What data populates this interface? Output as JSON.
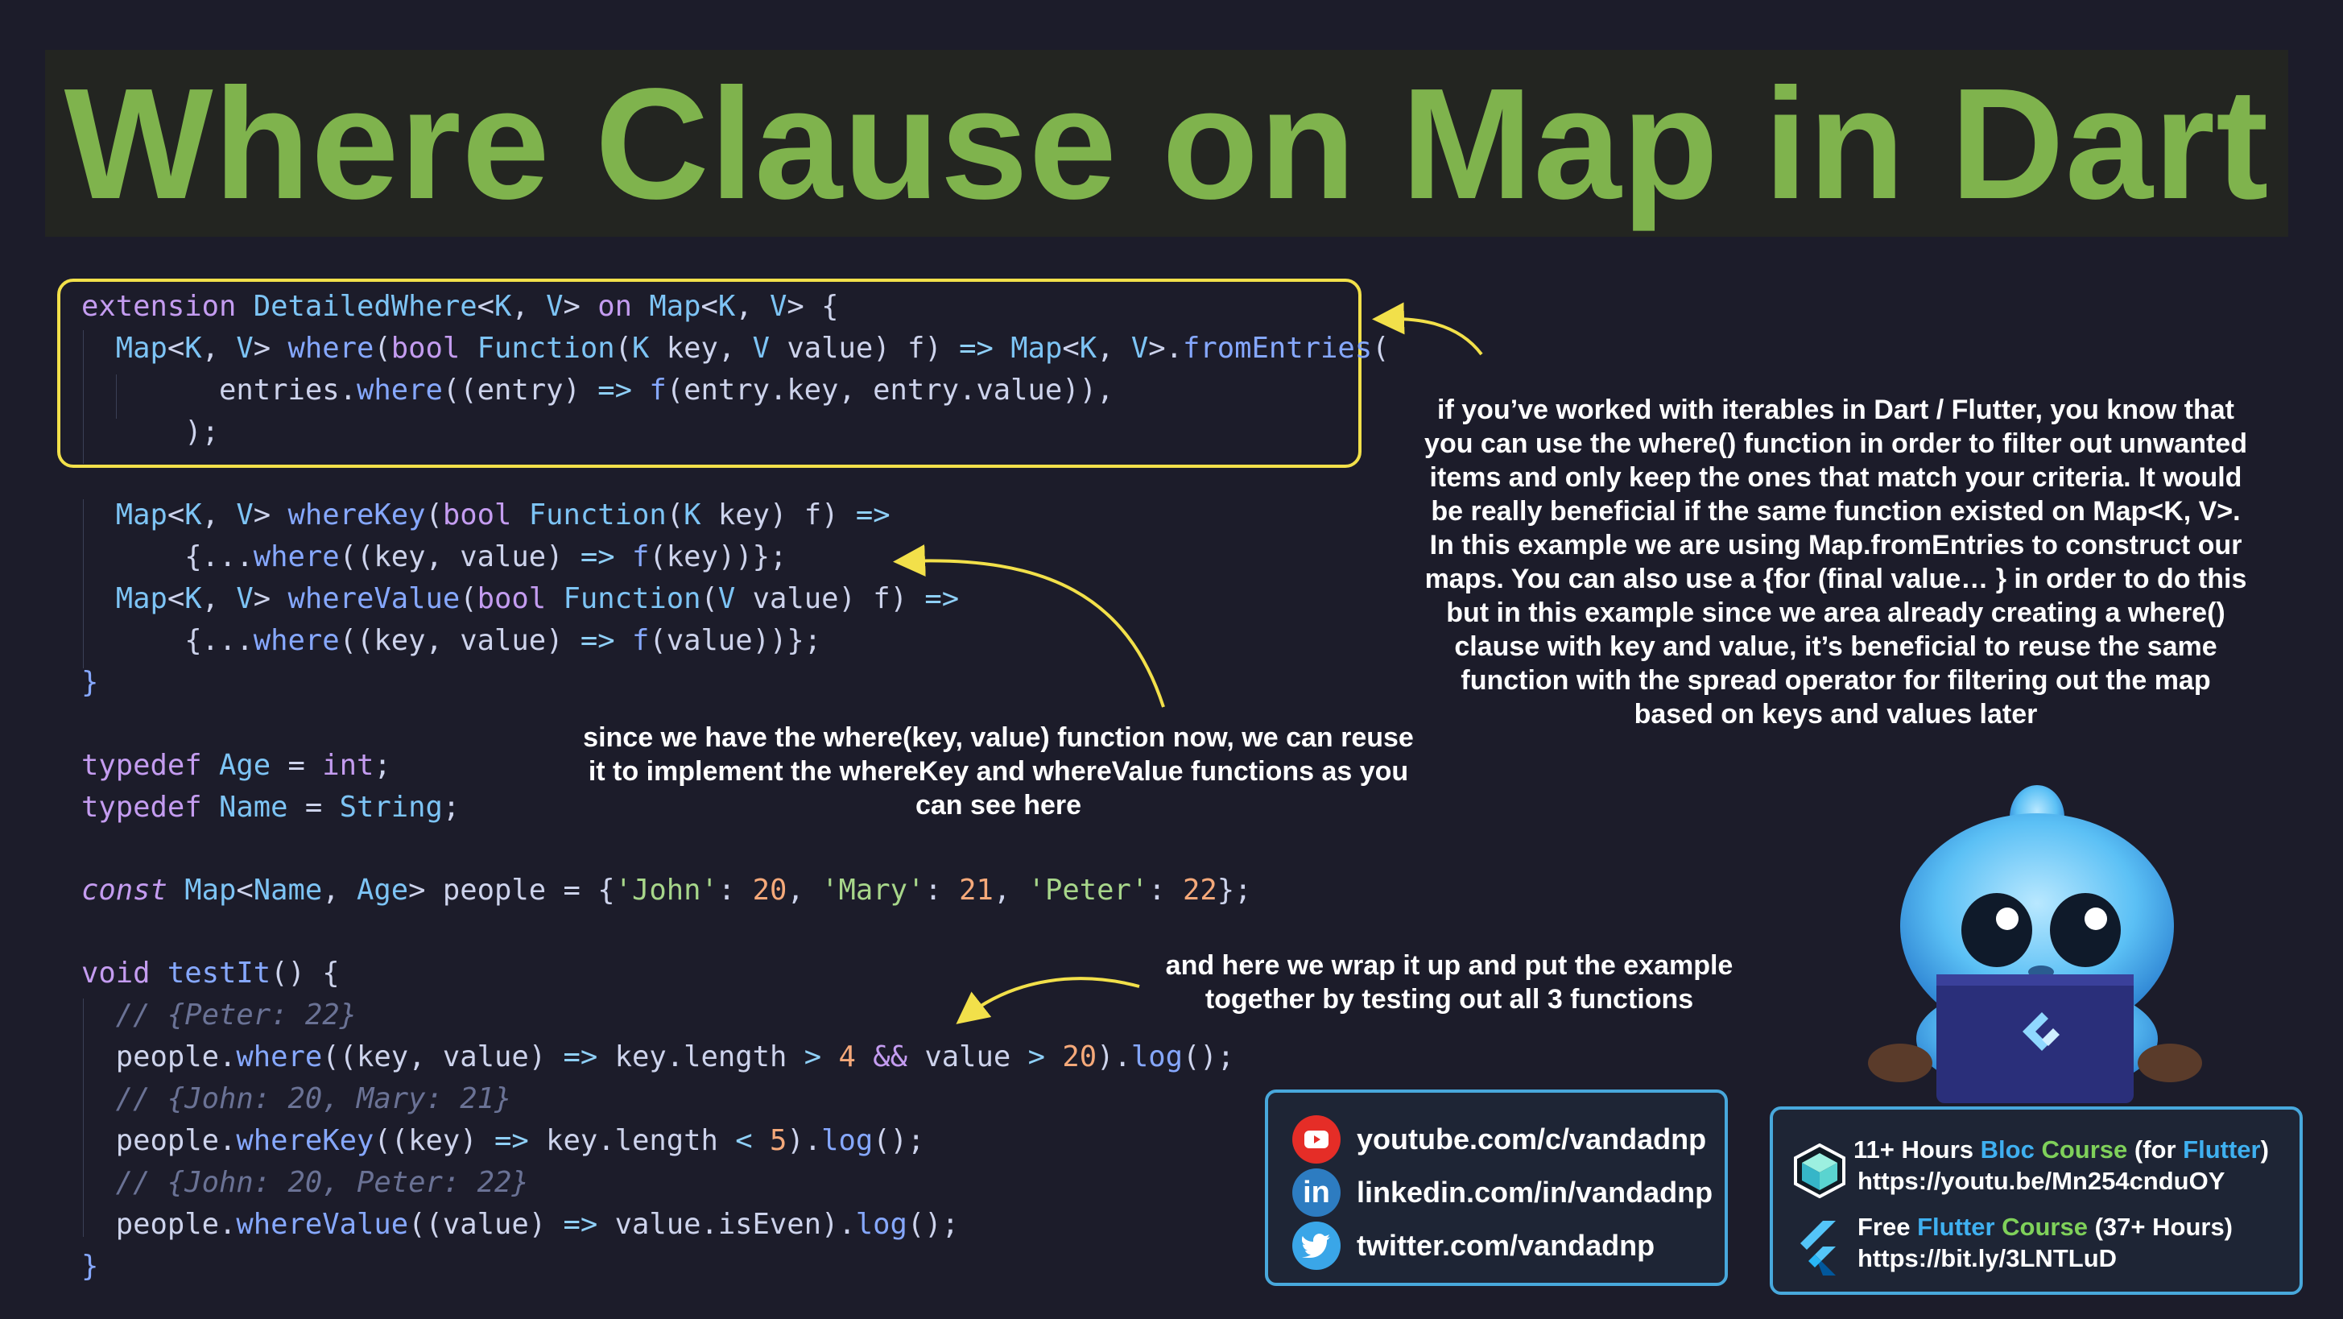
{
  "title": "Where Clause on Map in Dart",
  "code": {
    "lines": [
      "extension DetailedWhere<K, V> on Map<K, V> {",
      "  Map<K, V> where(bool Function(K key, V value) f) => Map<K, V>.fromEntries(",
      "        entries.where((entry) => f(entry.key, entry.value)),",
      "      );",
      "",
      "  Map<K, V> whereKey(bool Function(K key) f) =>",
      "      {...where((key, value) => f(key))};",
      "  Map<K, V> whereValue(bool Function(V value) f) =>",
      "      {...where((key, value) => f(value))};",
      "}",
      "",
      "typedef Age = int;",
      "typedef Name = String;",
      "",
      "const Map<Name, Age> people = {'John': 20, 'Mary': 21, 'Peter': 22};",
      "",
      "void testIt() {",
      "  // {Peter: 22}",
      "  people.where((key, value) => key.length > 4 && value > 20).log();",
      "  // {John: 20, Mary: 21}",
      "  people.whereKey((key) => key.length < 5).log();",
      "  // {John: 20, Peter: 22}",
      "  people.whereValue((value) => value.isEven).log();",
      "}"
    ]
  },
  "annotations": {
    "right_explanation": [
      "if you’ve worked with iterables in Dart / Flutter, you know that",
      "you can use the where() function in order to filter out unwanted",
      "items and only keep the ones that match your criteria. It would",
      "be really beneficial if the same function existed on Map<K, V>.",
      "In this example we are using Map.fromEntries to construct our",
      "maps. You can also use a {for (final value… } in order to do this",
      "but in this example since we area already creating a where()",
      "clause with key and value, it’s beneficial to reuse the same",
      "function with the spread operator for filtering out the map",
      "based on keys and values later"
    ],
    "middle_explanation": [
      "since we have the where(key, value) function now, we can reuse",
      "it to implement the whereKey and whereValue functions as you",
      "can see here"
    ],
    "bottom_explanation": [
      "and here we wrap it up and put the example",
      "together by testing out all 3 functions"
    ]
  },
  "social": [
    {
      "icon": "youtube-icon",
      "label": "youtube.com/c/vandadnp",
      "color": "#e52d27"
    },
    {
      "icon": "linkedin-icon",
      "label": "linkedin.com/in/vandadnp",
      "color": "#2d7cc1"
    },
    {
      "icon": "twitter-icon",
      "label": "twitter.com/vandadnp",
      "color": "#3aa6e8"
    }
  ],
  "promo": {
    "bloc_line1_a": "11+ Hours ",
    "bloc_line1_b": "Bloc",
    "bloc_line1_c": " ",
    "bloc_line1_d": "Course",
    "bloc_line1_e": " (for ",
    "bloc_line1_f": "Flutter",
    "bloc_line1_g": ")",
    "bloc_url": "https://youtu.be/Mn254cnduOY",
    "flutter_line1_a": "Free ",
    "flutter_line1_b": "Flutter",
    "flutter_line1_c": " ",
    "flutter_line1_d": "Course",
    "flutter_line1_e": " (37+ Hours)",
    "flutter_url": "https://bit.ly/3LNTLuD"
  },
  "colors": {
    "background": "#1c1c2a",
    "title": "#7fb34d",
    "highlight_box": "#f2e04a",
    "arrow": "#f2e04a",
    "box_border": "#48a8dc",
    "accent_blue": "#3fb0f0",
    "accent_green": "#7fd15a"
  }
}
